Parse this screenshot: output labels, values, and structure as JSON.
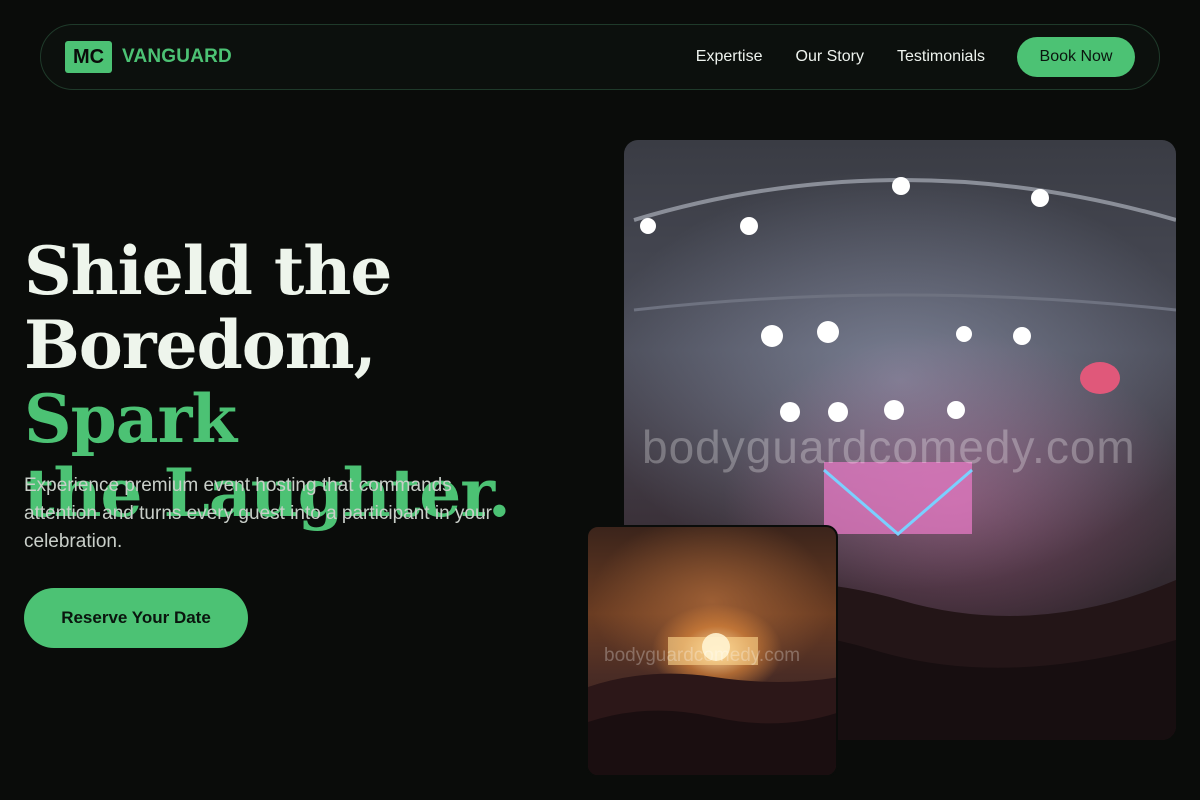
{
  "nav": {
    "logo_badge": "MC",
    "logo_text": "VANGUARD",
    "links": [
      "Expertise",
      "Our Story",
      "Testimonials"
    ],
    "cta": "Book Now"
  },
  "hero": {
    "title_line1": "Shield the",
    "title_line2a": "Boredom,",
    "title_line2b": "Spark",
    "title_line3": "the Laughter.",
    "subtitle": "Experience premium event hosting that commands attention and turns every guest into a participant in your celebration.",
    "cta": "Reserve Your Date"
  },
  "images": {
    "main_watermark": "bodyguardcomedy.com",
    "small_watermark": "bodyguardcomedy.com",
    "main_description": "concert-stage-confetti-crowd",
    "small_description": "concert-stage-lights-crowd"
  },
  "colors": {
    "accent": "#4cc274",
    "background": "#0a0c0a",
    "text": "#eef5ec"
  }
}
